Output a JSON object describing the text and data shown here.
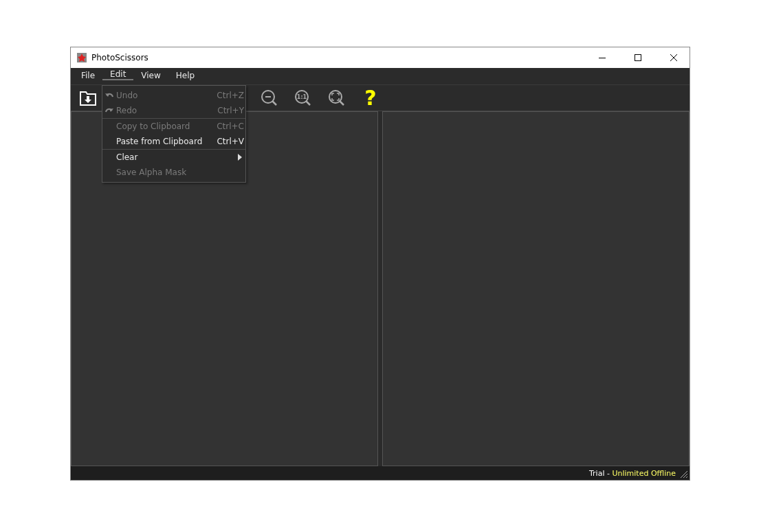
{
  "window": {
    "title": "PhotoScissors"
  },
  "menu_bar": [
    {
      "label": "File",
      "selected": false
    },
    {
      "label": "Edit",
      "selected": true
    },
    {
      "label": "View",
      "selected": false
    },
    {
      "label": "Help",
      "selected": false
    }
  ],
  "edit_menu": [
    {
      "label": "Undo",
      "shortcut": "Ctrl+Z",
      "disabled": true,
      "kind": "undo",
      "separator_before": false,
      "submenu": false
    },
    {
      "label": "Redo",
      "shortcut": "Ctrl+Y",
      "disabled": true,
      "kind": "redo",
      "separator_before": false,
      "submenu": false
    },
    {
      "label": "Copy to Clipboard",
      "shortcut": "Ctrl+C",
      "disabled": true,
      "kind": "plain",
      "separator_before": true,
      "submenu": false
    },
    {
      "label": "Paste from Clipboard",
      "shortcut": "Ctrl+V",
      "disabled": false,
      "kind": "plain",
      "separator_before": false,
      "submenu": false
    },
    {
      "label": "Clear",
      "disabled": false,
      "kind": "plain",
      "separator_before": true,
      "submenu": true
    },
    {
      "label": "Save Alpha Mask",
      "disabled": true,
      "kind": "plain",
      "separator_before": false,
      "submenu": false
    }
  ],
  "toolbar": [
    {
      "kind": "open"
    },
    {
      "kind": "zoom_out"
    },
    {
      "kind": "zoom_actual",
      "label": "1:1"
    },
    {
      "kind": "zoom_fit"
    },
    {
      "kind": "help",
      "label": "?"
    }
  ],
  "status_bar": {
    "prefix": "Trial - ",
    "highlight": "Unlimited Offline"
  }
}
